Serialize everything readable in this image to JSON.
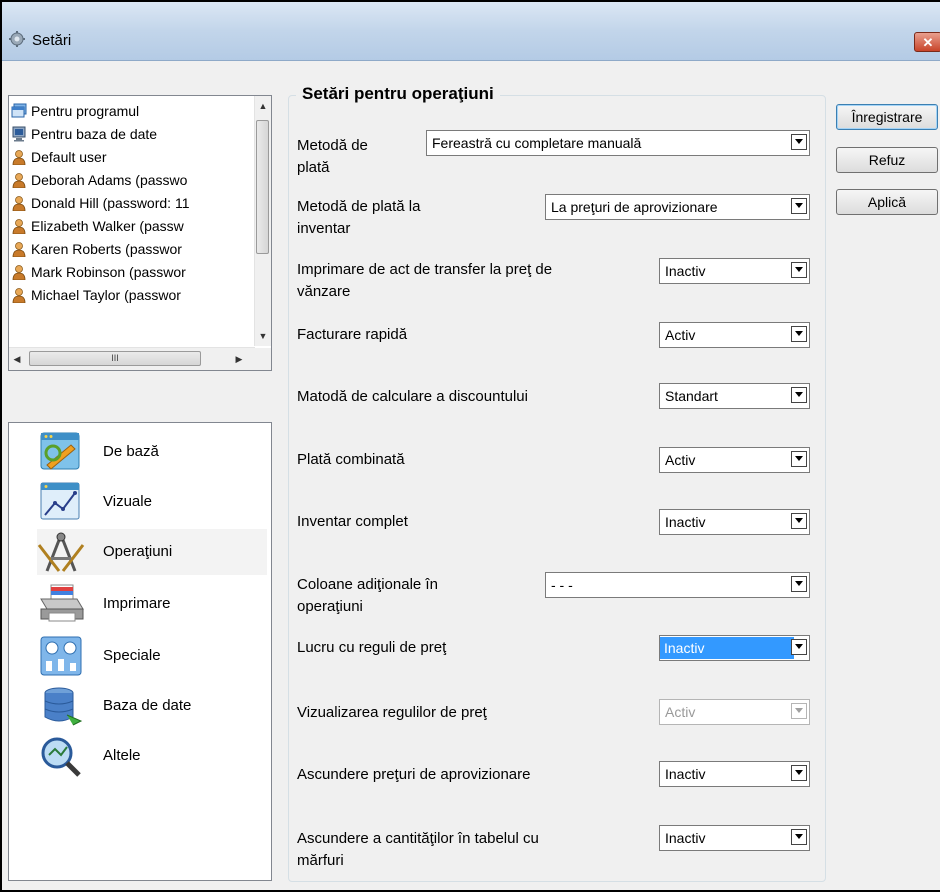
{
  "window": {
    "title": "Setări",
    "close_glyph": "✕"
  },
  "users": {
    "items": [
      {
        "label": "Pentru programul",
        "icon": "program-icon"
      },
      {
        "label": "Pentru baza de date",
        "icon": "database-monitor-icon"
      },
      {
        "label": "Default user",
        "icon": "user-icon"
      },
      {
        "label": "Deborah Adams (passwo",
        "icon": "user-icon"
      },
      {
        "label": "Donald Hill (password: 11",
        "icon": "user-icon"
      },
      {
        "label": "Elizabeth Walker (passw",
        "icon": "user-icon"
      },
      {
        "label": "Karen Roberts (passwor",
        "icon": "user-icon"
      },
      {
        "label": "Mark Robinson (passwor",
        "icon": "user-icon"
      },
      {
        "label": "Michael Taylor (passwor",
        "icon": "user-icon"
      }
    ],
    "scroll_thumb_glyph": "III"
  },
  "categories": [
    {
      "label": "De bază",
      "icon": "basic-settings-icon"
    },
    {
      "label": "Vizuale",
      "icon": "visual-chart-icon"
    },
    {
      "label": "Operaţiuni",
      "icon": "compass-tools-icon",
      "selected": true
    },
    {
      "label": "Imprimare",
      "icon": "printer-icon"
    },
    {
      "label": "Speciale",
      "icon": "special-settings-icon"
    },
    {
      "label": "Baza de date",
      "icon": "database-icon"
    },
    {
      "label": "Altele",
      "icon": "magnifier-icon"
    }
  ],
  "settings": {
    "title": "Setări pentru operaţiuni",
    "rows": [
      {
        "label": "Metodă de\nplată",
        "value": "Fereastră cu completare manuală"
      },
      {
        "label": "Metodă de plată la\ninventar",
        "value": "La preţuri de aprovizionare"
      },
      {
        "label": "Imprimare de act de transfer la preţ de\nvănzare",
        "value": "Inactiv"
      },
      {
        "label": "Facturare rapidă",
        "value": "Activ"
      },
      {
        "label": "Matodă de calculare a discountului",
        "value": "Standart"
      },
      {
        "label": "Plată combinată",
        "value": "Activ"
      },
      {
        "label": "Inventar complet",
        "value": "Inactiv"
      },
      {
        "label": "Coloane adiţionale în\noperaţiuni",
        "value": "- - -"
      },
      {
        "label": "Lucru cu reguli de preţ",
        "value": "Inactiv",
        "highlighted": true
      },
      {
        "label": "Vizualizarea regulilor de preţ",
        "value": "Activ",
        "disabled": true
      },
      {
        "label": "Ascundere preţuri de aprovizionare",
        "value": "Inactiv"
      },
      {
        "label": "Ascundere a cantităţilor în tabelul cu\nmărfuri",
        "value": "Inactiv"
      }
    ]
  },
  "buttons": {
    "save": "Înregistrare",
    "cancel": "Refuz",
    "apply": "Aplică"
  },
  "colors": {
    "selection": "#3399ff",
    "titlebar": "#c2d5ea",
    "close": "#c8442a"
  }
}
